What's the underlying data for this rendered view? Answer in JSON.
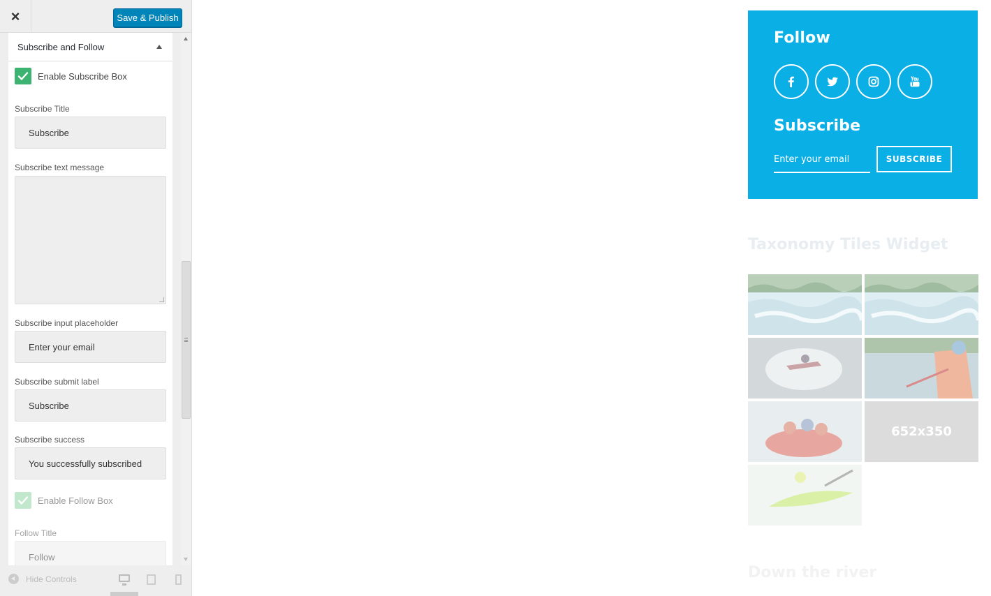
{
  "customizer": {
    "close_label": "×",
    "publish_label": "Save & Publish",
    "section_title": "Subscribe and Follow",
    "enable_subscribe_label": "Enable Subscribe Box",
    "enable_subscribe_checked": true,
    "fields": {
      "subscribe_title": {
        "label": "Subscribe Title",
        "value": "Subscribe"
      },
      "subscribe_text": {
        "label": "Subscribe text message",
        "value": ""
      },
      "subscribe_placeholder": {
        "label": "Subscribe input placeholder",
        "value": "Enter your email"
      },
      "subscribe_submit": {
        "label": "Subscribe submit label",
        "value": "Subscribe"
      },
      "subscribe_success": {
        "label": "Subscribe success",
        "value": "You successfully subscribed"
      },
      "follow_title": {
        "label": "Follow Title",
        "value": "Follow"
      }
    },
    "enable_follow_label": "Enable Follow Box",
    "enable_follow_checked": true,
    "footer": {
      "hide_controls_label": "Hide Controls"
    }
  },
  "preview": {
    "follow_heading": "Follow",
    "social_icons": [
      "facebook-icon",
      "twitter-icon",
      "instagram-icon",
      "youtube-icon"
    ],
    "subscribe_heading": "Subscribe",
    "email_placeholder": "Enter your email",
    "subscribe_button": "SUBSCRIBE",
    "taxonomy_title": "Taxonomy Tiles Widget",
    "placeholder_tile_label": "652x350",
    "next_title": "Down the river"
  },
  "colors": {
    "widget_blue": "#0aafe6",
    "publish_blue": "#0085ba",
    "checkbox_green": "#3cb371"
  }
}
